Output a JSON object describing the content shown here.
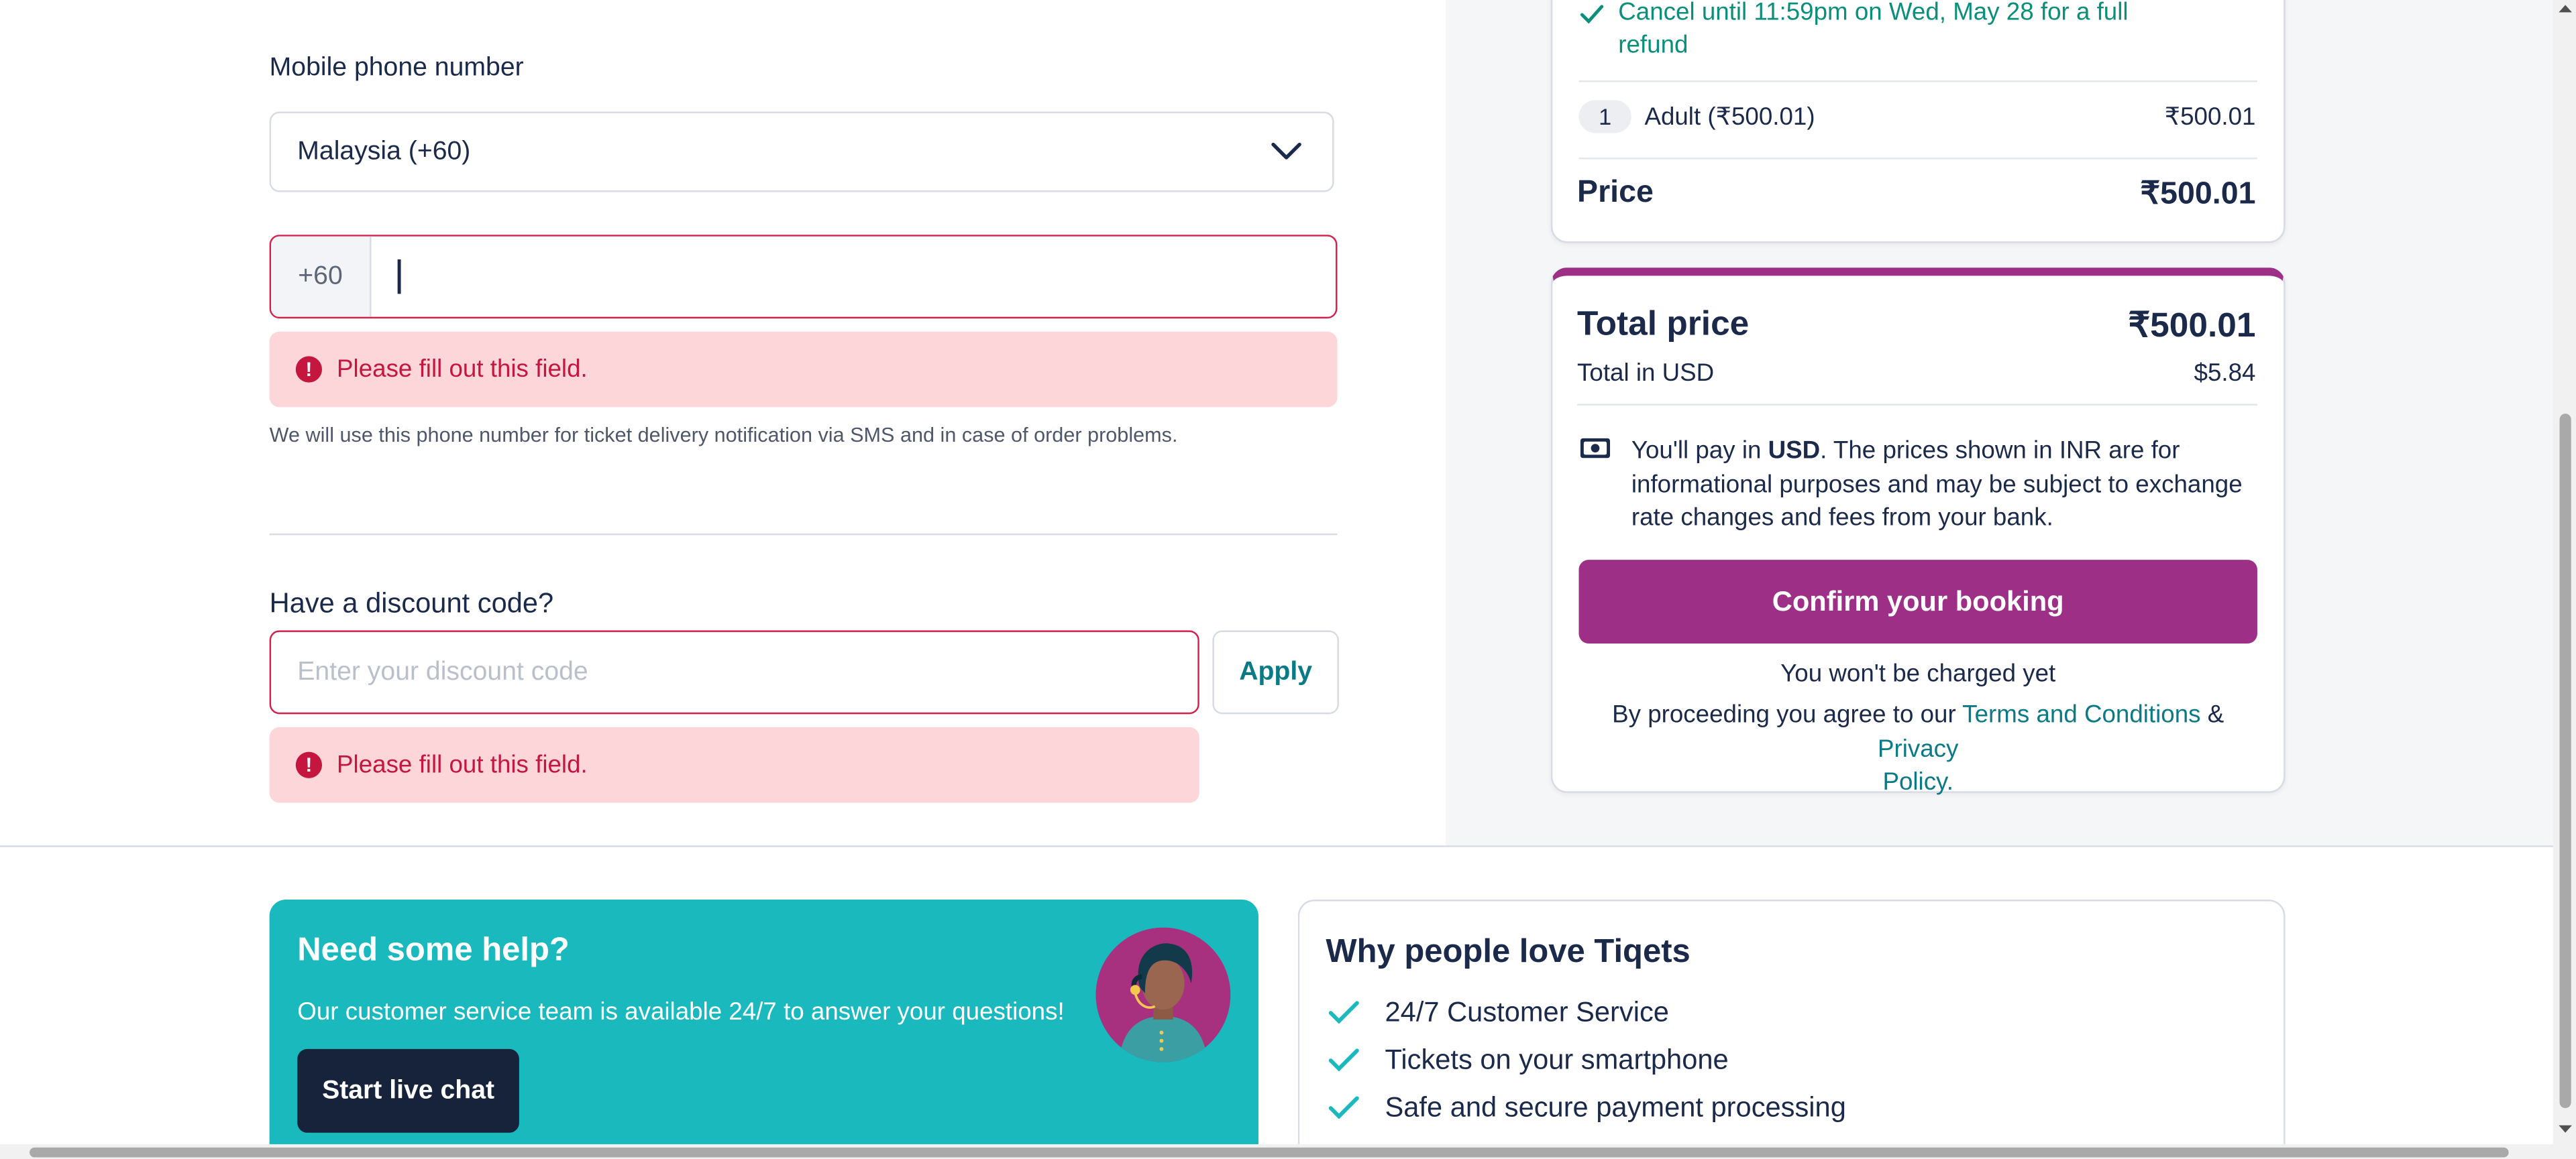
{
  "phone": {
    "label": "Mobile phone number",
    "country_value": "Malaysia (+60)",
    "prefix": "+60",
    "value": "",
    "error": "Please fill out this field.",
    "hint": "We will use this phone number for ticket delivery notification via SMS and in case of order problems."
  },
  "discount": {
    "label": "Have a discount code?",
    "placeholder": "Enter your discount code",
    "apply_label": "Apply",
    "error": "Please fill out this field."
  },
  "summary": {
    "cancel_line1": "Cancel until 11:59pm on Wed, May 28 for a full",
    "cancel_line2": "refund",
    "qty": "1",
    "ticket_label": "Adult (₹500.01)",
    "ticket_price": "₹500.01",
    "price_label": "Price",
    "price_value": "₹500.01"
  },
  "total": {
    "label": "Total price",
    "value": "₹500.01",
    "usd_label": "Total in USD",
    "usd_value": "$5.84",
    "pay_prefix": "You'll pay in ",
    "pay_currency": "USD",
    "pay_line1_rest": ". The prices shown in INR are for",
    "pay_line2": "informational purposes and may be subject to exchange",
    "pay_line3": "rate changes and fees from your bank.",
    "confirm_label": "Confirm your booking",
    "not_charged": "You won't be charged yet",
    "agree_prefix": "By proceeding you agree to our ",
    "terms_link": "Terms and Conditions",
    "amp": " & ",
    "privacy_link_part1": "Privacy",
    "privacy_link_part2": "Policy",
    "period": "."
  },
  "help": {
    "title": "Need some help?",
    "text": "Our customer service team is available 24/7 to answer your questions!",
    "chat_label": "Start live chat"
  },
  "why": {
    "title": "Why people love Tiqets",
    "items": [
      "24/7 Customer Service",
      "Tickets on your smartphone",
      "Safe and secure payment processing"
    ]
  },
  "colors": {
    "brand_purple": "#9d2f86",
    "teal": "#19b9bd",
    "error_red": "#c4163f",
    "navy": "#17223b"
  },
  "icons": [
    "chevron-down-icon",
    "error-icon",
    "check-icon",
    "money-icon",
    "support-agent-avatar"
  ]
}
